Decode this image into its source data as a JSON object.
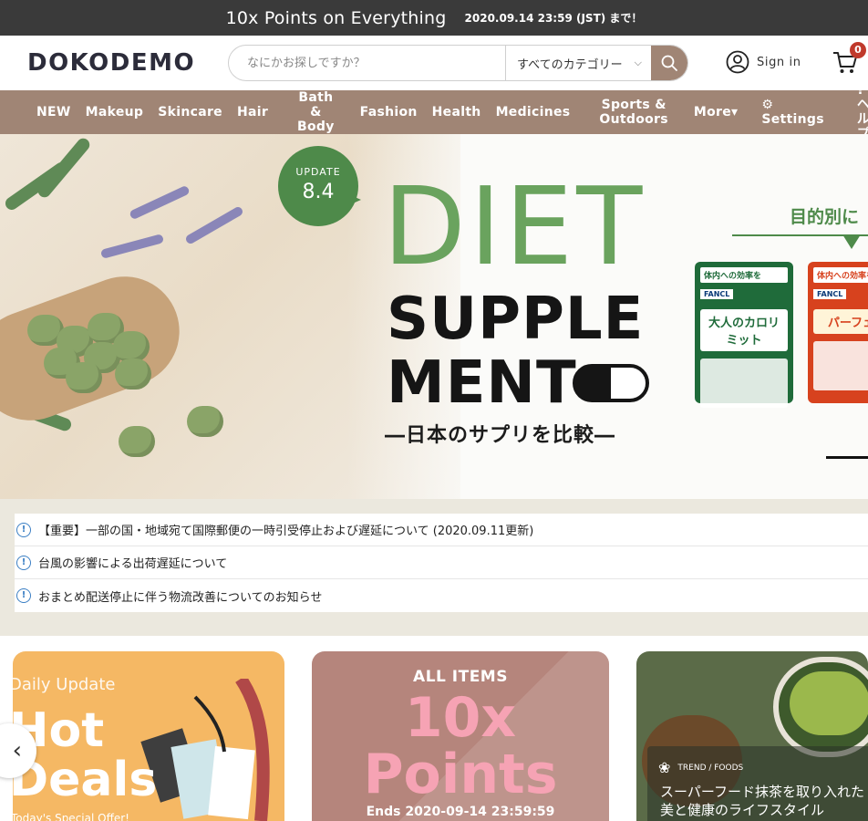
{
  "promo": {
    "title": "10x Points on Everything",
    "deadline": "2020.09.14 23:59 (JST) まで！"
  },
  "header": {
    "logo": "DOKODEMO",
    "search": {
      "placeholder": "なにかお探しですか？",
      "category": "すべてのカテゴリー"
    },
    "signin_label": "Sign in",
    "cart_count": "0"
  },
  "nav": {
    "items": [
      {
        "label": "NEW"
      },
      {
        "label": "Makeup"
      },
      {
        "label": "Skincare"
      },
      {
        "label": "Hair"
      },
      {
        "label": "Bath &\nBody"
      },
      {
        "label": "Fashion"
      },
      {
        "label": "Health"
      },
      {
        "label": "Medicines"
      },
      {
        "label": "Sports &\nOutdoors"
      },
      {
        "label": "More▾"
      },
      {
        "label": "⚙\nSettings"
      },
      {
        "label": "? ヘル\nプ"
      }
    ]
  },
  "hero": {
    "update_label": "UPDATE",
    "update_value": "8.4",
    "line1": "DIET",
    "line2": "SUPPLE",
    "line3": "MENT",
    "subtitle": "―日本のサプリを比較―",
    "side_heading": "目的別に",
    "products": [
      {
        "header": "体内への効率を",
        "brand": "FANCL",
        "name": "大人のカロリミット"
      },
      {
        "header": "体内への効率を",
        "brand": "FANCL",
        "name": "パーフェク"
      }
    ]
  },
  "notices": [
    {
      "text": "【重要】一部の国・地域宛て国際郵便の一時引受停止および遅延について (2020.09.11更新)"
    },
    {
      "text": "台風の影響による出荷遅延について"
    },
    {
      "text": "おまとめ配送停止に伴う物流改善についてのお知らせ"
    }
  ],
  "cards": {
    "hot_deals": {
      "small": "Daily Update",
      "big": "Hot\nDeals",
      "sub": "Today's Special Offer!"
    },
    "points": {
      "label": "ALL ITEMS",
      "big": "10x\nPoints",
      "ends": "Ends 2020-09-14 23:59:59"
    },
    "trend": {
      "tag": "TREND / FOODS",
      "title": "スーパーフード抹茶を取り入れた\n美と健康のライフスタイル"
    }
  },
  "colors": {
    "nav_bg": "#a08575",
    "promo_bg": "#3a3a3a",
    "diet_green": "#6aa35e",
    "badge_green": "#4e8a4a",
    "points_pink": "#f6a3b4"
  },
  "icons": {
    "search": "search-icon",
    "user": "user-icon",
    "cart": "cart-icon",
    "notice": "info-icon",
    "prev": "chevron-left-icon"
  }
}
